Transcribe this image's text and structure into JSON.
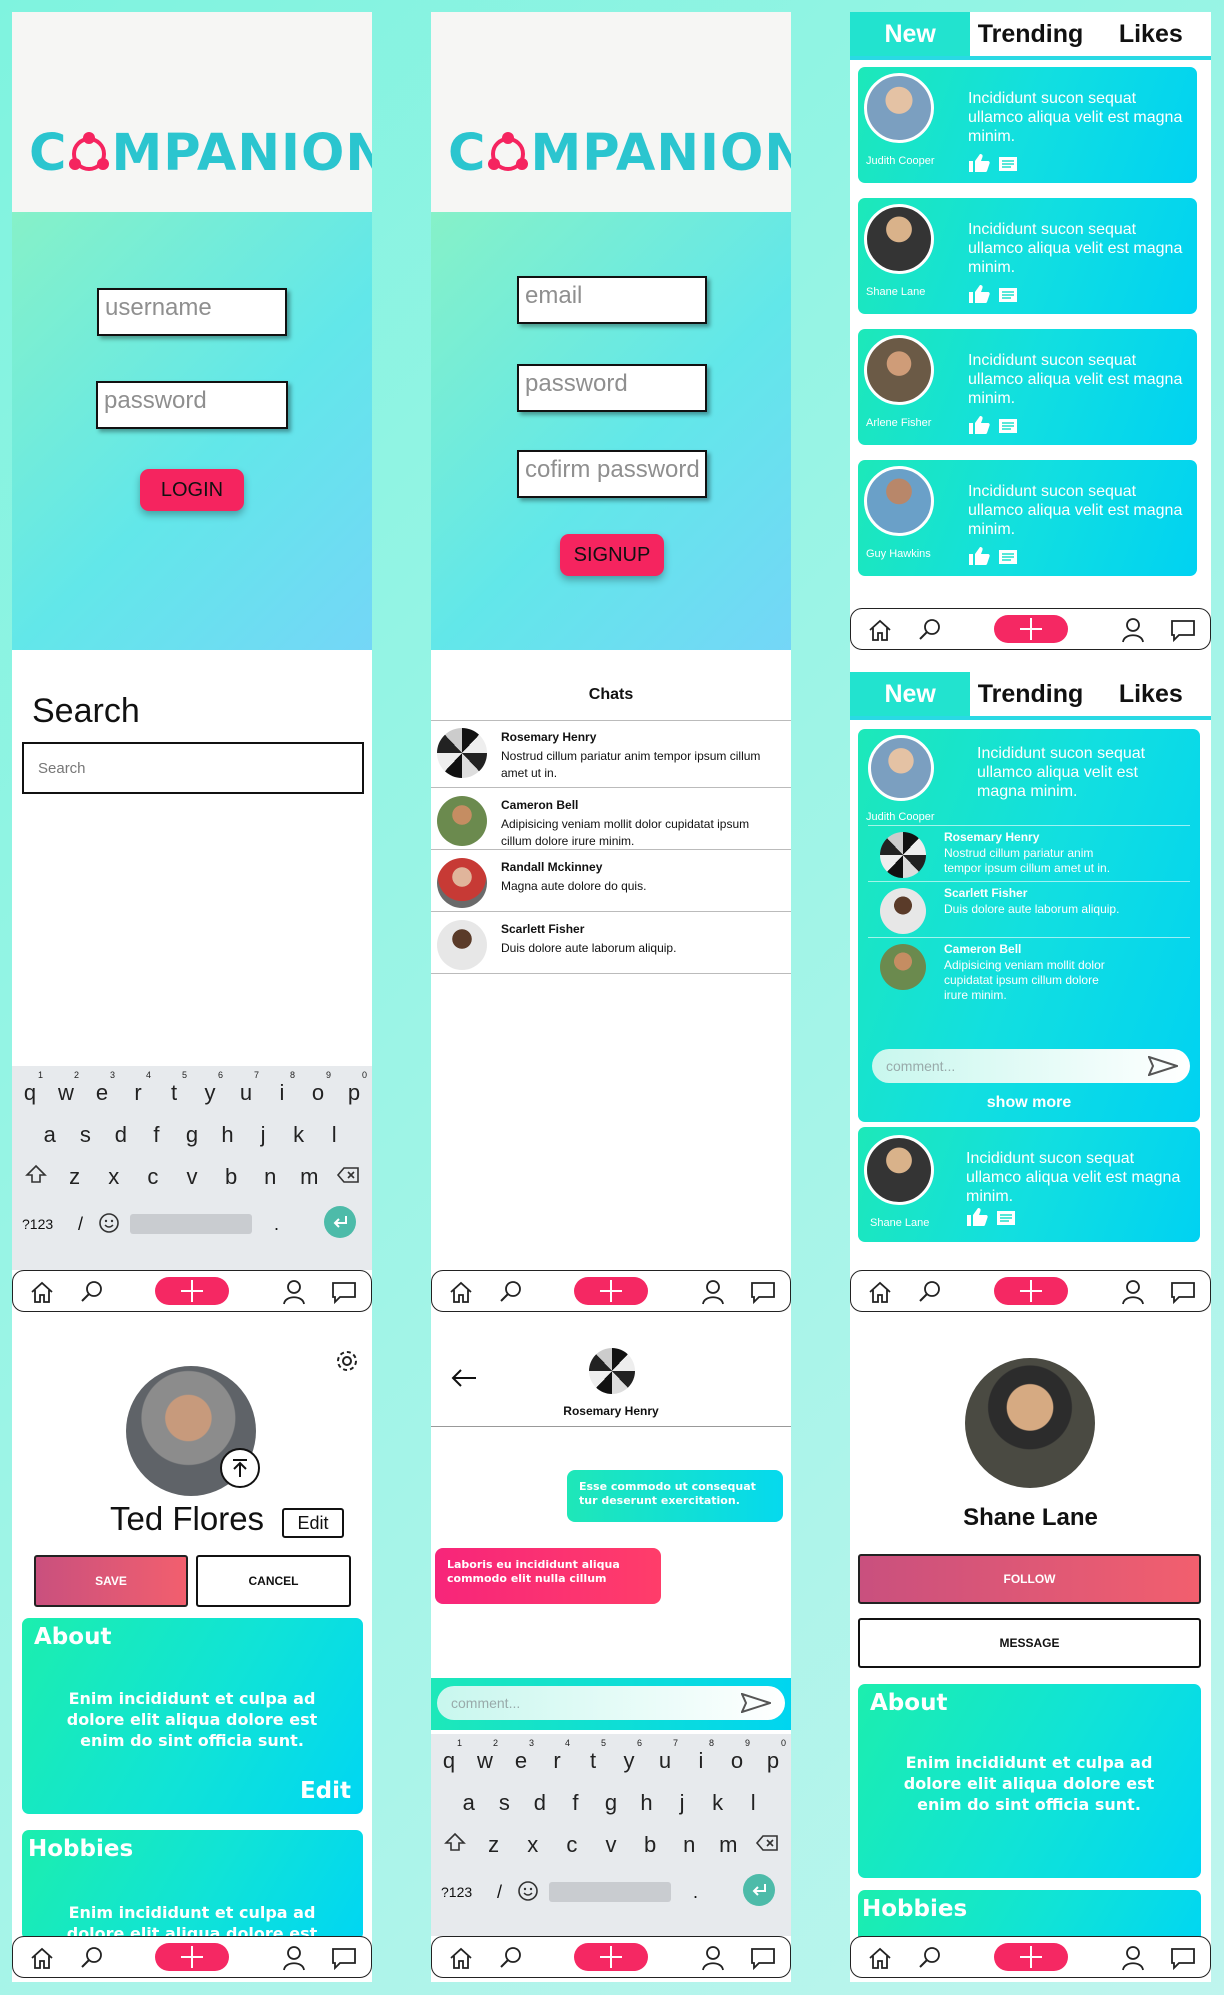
{
  "logo": {
    "prefix": "C",
    "suffix": "MPANION"
  },
  "login": {
    "username_placeholder": "username",
    "password_placeholder": "password",
    "login_label": "LOGIN"
  },
  "signup": {
    "email_placeholder": "email",
    "password_placeholder": "password",
    "confirm_placeholder": "cofirm password",
    "signup_label": "SIGNUP"
  },
  "feed_tabs": [
    "New",
    "Trending",
    "Likes"
  ],
  "feed": [
    {
      "name": "Judith Cooper",
      "text": "Incididunt sucon sequat ullamco aliqua velit est magna minim."
    },
    {
      "name": "Shane Lane",
      "text": "Incididunt sucon sequat ullamco aliqua velit est magna minim."
    },
    {
      "name": "Arlene Fisher",
      "text": "Incididunt sucon sequat ullamco aliqua velit est magna minim."
    },
    {
      "name": "Guy Hawkins",
      "text": "Incididunt sucon sequat ullamco aliqua velit est magna minim."
    }
  ],
  "search": {
    "title": "Search",
    "placeholder": "Search"
  },
  "keyboard": {
    "row1": [
      "q",
      "w",
      "e",
      "r",
      "t",
      "y",
      "u",
      "i",
      "o",
      "p"
    ],
    "digits": [
      "1",
      "2",
      "3",
      "4",
      "5",
      "6",
      "7",
      "8",
      "9",
      "0"
    ],
    "row2": [
      "a",
      "s",
      "d",
      "f",
      "g",
      "h",
      "j",
      "k",
      "l"
    ],
    "row3": [
      "z",
      "x",
      "c",
      "v",
      "b",
      "n",
      "m"
    ],
    "sym": "?123",
    "slash": "/",
    "dot": "."
  },
  "chats": {
    "title": "Chats",
    "items": [
      {
        "name": "Rosemary Henry",
        "msg": "Nostrud cillum pariatur anim tempor ipsum cillum amet ut in."
      },
      {
        "name": "Cameron Bell",
        "msg": "Adipisicing veniam mollit dolor cupidatat ipsum cillum dolore irure minim."
      },
      {
        "name": "Randall Mckinney",
        "msg": "Magna aute dolore do quis."
      },
      {
        "name": "Scarlett Fisher",
        "msg": "Duis dolore aute laborum aliquip."
      }
    ]
  },
  "expanded": {
    "post_name": "Judith Cooper",
    "post_text": "Incididunt sucon sequat ullamco aliqua velit est magna minim.",
    "comments": [
      {
        "name": "Rosemary Henry",
        "text": "Nostrud cillum pariatur anim tempor ipsum cillum amet ut in."
      },
      {
        "name": "Scarlett Fisher",
        "text": "Duis dolore aute laborum aliquip."
      },
      {
        "name": "Cameron Bell",
        "text": "Adipisicing veniam mollit dolor cupidatat ipsum cillum dolore irure minim."
      }
    ],
    "comment_placeholder": "comment...",
    "show_more": "show more",
    "next_name": "Shane Lane",
    "next_text": "Incididunt sucon sequat ullamco aliqua velit est magna minim."
  },
  "my_profile": {
    "name": "Ted Flores",
    "edit": "Edit",
    "save": "SAVE",
    "cancel": "CANCEL",
    "about_title": "About",
    "about_text": "Enim incididunt et culpa ad dolore elit aliqua dolore est enim do sint officia sunt.",
    "about_edit": "Edit",
    "hobbies_title": "Hobbies",
    "hobbies_text": "Enim incididunt et culpa ad dolore elit aliqua dolore est"
  },
  "conversation": {
    "contact": "Rosemary Henry",
    "sent": "Esse commodo ut consequat tur deserunt exercitation.",
    "received": "Laboris eu incididunt aliqua commodo elit nulla cillum",
    "placeholder": "comment..."
  },
  "other_profile": {
    "name": "Shane Lane",
    "follow": "FOLLOW",
    "message": "MESSAGE",
    "about_title": "About",
    "about_text": "Enim incididunt et culpa ad dolore elit aliqua dolore est enim do sint officia sunt.",
    "hobbies_title": "Hobbies"
  },
  "colors": {
    "accent": "#f5245f",
    "teal": "#22e3cf",
    "logo": "#2bc5cf"
  }
}
